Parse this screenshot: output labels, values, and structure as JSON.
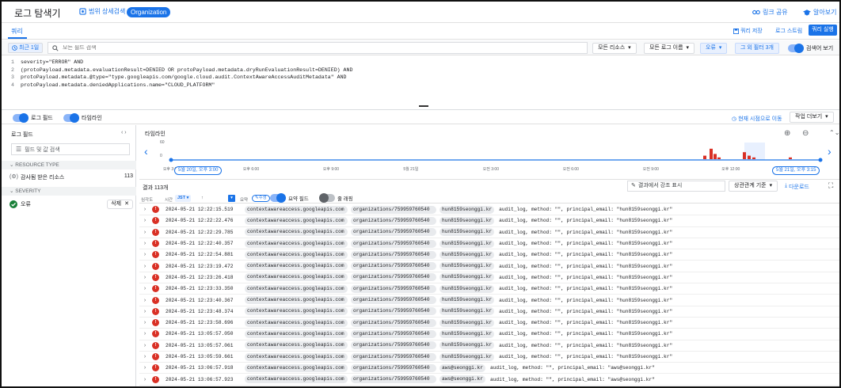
{
  "app": {
    "title": "로그 탐색기",
    "scope_label": "범위 상세검색",
    "org_chip": "Organization",
    "share_link": "링크 공유",
    "help": "알아보기"
  },
  "query_tab": {
    "label": "쿼리",
    "save": "쿼리 저장",
    "stream": "로그 스트림",
    "run": "쿼리 실행"
  },
  "toolbar": {
    "recent": "최근 1일",
    "search_placeholder": "모든 필드 검색",
    "all_resources": "모든 리소스",
    "all_log_names": "모든 로그 이름",
    "error": "오류",
    "correlate": "그 외 필터 3개",
    "show_query_label": "검색어 보기"
  },
  "query_lines": [
    {
      "num": "1",
      "text": "severity=\"ERROR\" AND"
    },
    {
      "num": "2",
      "text": "(protoPayload.metadata.evaluationResult=DENIED OR protoPayload.metadata.dryRunEvaluationResult=DENIED) AND"
    },
    {
      "num": "3",
      "text": "protoPayload.metadata.@type=\"type.googleapis.com/google.cloud.audit.ContextAwareAccessAuditMetadata\" AND"
    },
    {
      "num": "4",
      "text": "protoPayload.metadata.deniedApplications.name=\"CLOUD_PLATFORM\""
    }
  ],
  "panel_toggles": {
    "log_fields": "로그 필드",
    "timeline": "타임라인",
    "jump_now": "현재 시점으로 이동",
    "more_actions": "작업 더보기"
  },
  "log_fields": {
    "title": "로그 필드",
    "search_placeholder": "필드 및 값 검색",
    "sections": [
      {
        "header": "RESOURCE TYPE",
        "items": [
          {
            "label": "감사됨 받은 리소스",
            "count": "113"
          }
        ]
      },
      {
        "header": "SEVERITY",
        "items": [
          {
            "label": "오류",
            "clear": "삭제"
          }
        ]
      }
    ]
  },
  "timeline": {
    "title": "타임라인",
    "y_top": "60",
    "y_bottom": "0",
    "range_start": "5월 20일, 오후 3:00",
    "range_end": "5월 21일, 오후 3:15"
  },
  "chart_data": {
    "type": "bar",
    "title": "타임라인",
    "x_tick_labels": [
      "오후 3:00",
      "오후 6:00",
      "오후 9:00",
      "5월 21일",
      "오전 3:00",
      "오전 6:00",
      "오전 9:00",
      "오후 12:00",
      "오후 3:00"
    ],
    "x": [
      "오전 11:45",
      "오전 11:55",
      "오후 12:00",
      "오후 12:05",
      "오후 12:20",
      "오후 12:25",
      "오후 12:30",
      "오후 1:05"
    ],
    "values": [
      2,
      6,
      3,
      1,
      4,
      2,
      1,
      1
    ],
    "ylim": [
      0,
      60
    ],
    "grid": false,
    "legend": "none"
  },
  "results": {
    "count_label": "결과 113개",
    "summary_toggle": "요약 필드",
    "wrap_toggle": "줄 래핑",
    "find_placeholder": "결과에서 강조 표시",
    "correlate": "상관관계 기준",
    "download": "다운로드"
  },
  "table_head": {
    "severity": "심각도",
    "time": "시간",
    "timezone": "JST",
    "summary": "요약",
    "edit": "수정"
  },
  "log_rows": [
    {
      "ts": "2024-05-21 12:22:15.519",
      "svc": "contextawareaccess.googleapis.com",
      "org": "organizations/759959760540",
      "user": "hun8159seonggi.kr",
      "msg": "audit_log, method: \"\", principal_email: \"hun8159seonggi.kr\""
    },
    {
      "ts": "2024-05-21 12:22:22.476",
      "svc": "contextawareaccess.googleapis.com",
      "org": "organizations/759959760540",
      "user": "hun8159seonggi.kr",
      "msg": "audit_log, method: \"\", principal_email: \"hun8159seonggi.kr\""
    },
    {
      "ts": "2024-05-21 12:22:29.785",
      "svc": "contextawareaccess.googleapis.com",
      "org": "organizations/759959760540",
      "user": "hun8159seonggi.kr",
      "msg": "audit_log, method: \"\", principal_email: \"hun8159seonggi.kr\""
    },
    {
      "ts": "2024-05-21 12:22:40.357",
      "svc": "contextawareaccess.googleapis.com",
      "org": "organizations/759959760540",
      "user": "hun8159seonggi.kr",
      "msg": "audit_log, method: \"\", principal_email: \"hun8159seonggi.kr\""
    },
    {
      "ts": "2024-05-21 12:22:54.881",
      "svc": "contextawareaccess.googleapis.com",
      "org": "organizations/759959760540",
      "user": "hun8159seonggi.kr",
      "msg": "audit_log, method: \"\", principal_email: \"hun8159seonggi.kr\""
    },
    {
      "ts": "2024-05-21 12:23:19.472",
      "svc": "contextawareaccess.googleapis.com",
      "org": "organizations/759959760540",
      "user": "hun8159seonggi.kr",
      "msg": "audit_log, method: \"\", principal_email: \"hun8159seonggi.kr\""
    },
    {
      "ts": "2024-05-21 12:23:26.418",
      "svc": "contextawareaccess.googleapis.com",
      "org": "organizations/759959760540",
      "user": "hun8159seonggi.kr",
      "msg": "audit_log, method: \"\", principal_email: \"hun8159seonggi.kr\""
    },
    {
      "ts": "2024-05-21 12:23:33.350",
      "svc": "contextawareaccess.googleapis.com",
      "org": "organizations/759959760540",
      "user": "hun8159seonggi.kr",
      "msg": "audit_log, method: \"\", principal_email: \"hun8159seonggi.kr\""
    },
    {
      "ts": "2024-05-21 12:23:40.367",
      "svc": "contextawareaccess.googleapis.com",
      "org": "organizations/759959760540",
      "user": "hun8159seonggi.kr",
      "msg": "audit_log, method: \"\", principal_email: \"hun8159seonggi.kr\""
    },
    {
      "ts": "2024-05-21 12:23:48.374",
      "svc": "contextawareaccess.googleapis.com",
      "org": "organizations/759959760540",
      "user": "hun8159seonggi.kr",
      "msg": "audit_log, method: \"\", principal_email: \"hun8159seonggi.kr\""
    },
    {
      "ts": "2024-05-21 12:23:58.696",
      "svc": "contextawareaccess.googleapis.com",
      "org": "organizations/759959760540",
      "user": "hun8159seonggi.kr",
      "msg": "audit_log, method: \"\", principal_email: \"hun8159seonggi.kr\""
    },
    {
      "ts": "2024-05-21 13:05:57.050",
      "svc": "contextawareaccess.googleapis.com",
      "org": "organizations/759959760540",
      "user": "hun8159seonggi.kr",
      "msg": "audit_log, method: \"\", principal_email: \"hun8159seonggi.kr\""
    },
    {
      "ts": "2024-05-21 13:05:57.061",
      "svc": "contextawareaccess.googleapis.com",
      "org": "organizations/759959760540",
      "user": "hun8159seonggi.kr",
      "msg": "audit_log, method: \"\", principal_email: \"hun8159seonggi.kr\""
    },
    {
      "ts": "2024-05-21 13:05:59.661",
      "svc": "contextawareaccess.googleapis.com",
      "org": "organizations/759959760540",
      "user": "hun8159seonggi.kr",
      "msg": "audit_log, method: \"\", principal_email: \"hun8159seonggi.kr\""
    },
    {
      "ts": "2024-05-21 13:06:57.918",
      "svc": "contextawareaccess.googleapis.com",
      "org": "organizations/759959760540",
      "user": "aws@seonggi.kr",
      "msg": "audit_log, method: \"\", principal_email: \"aws@seonggi.kr\""
    },
    {
      "ts": "2024-05-21 13:06:57.923",
      "svc": "contextawareaccess.googleapis.com",
      "org": "organizations/759959760540",
      "user": "aws@seonggi.kr",
      "msg": "audit_log, method: \"\", principal_email: \"aws@seonggi.kr\""
    }
  ],
  "colors": {
    "accent": "#1a73e8",
    "error": "#d93025",
    "chip": "#e8eaed",
    "bar": "#d93025"
  }
}
